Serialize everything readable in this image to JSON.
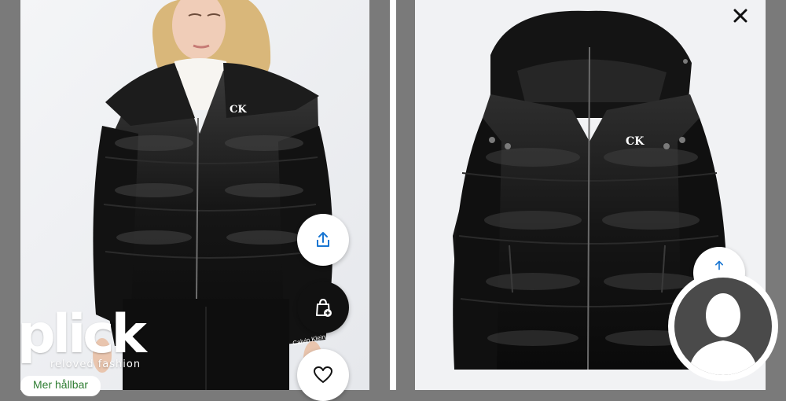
{
  "app": {
    "name": "plick",
    "tagline": "reloved fashion"
  },
  "left_view": {
    "image": "model-wearing-black-puffer-jacket",
    "brand_mark": "CK",
    "sleeve_label": "Calvin Klein",
    "badge_label": "Mer hållbar"
  },
  "right_view": {
    "image": "black-hooded-puffer-jacket-product",
    "brand_mark": "CK"
  },
  "actions": {
    "share_icon": "share-icon",
    "add_to_bag_icon": "bag-plus-icon",
    "favorite_icon": "heart-icon",
    "close_icon": "close-icon"
  },
  "overlay": {
    "avatar": "user-avatar-silhouette"
  },
  "colors": {
    "jacket": "#151515",
    "badge_text": "#2e7d32",
    "accent_dark": "#111111"
  }
}
